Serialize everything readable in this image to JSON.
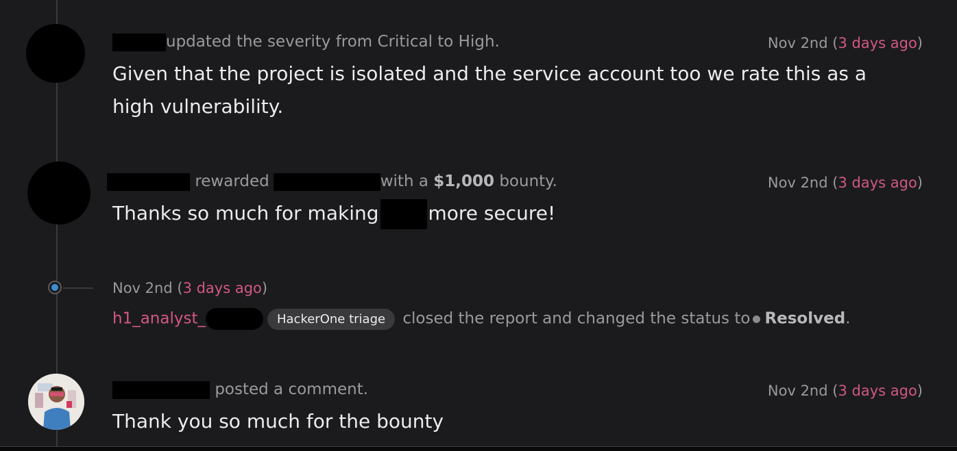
{
  "events": [
    {
      "action": "updated the severity from Critical to High.",
      "date": "Nov 2nd",
      "relative": "3 days ago",
      "body": "Given that the project is isolated and the service account too we rate this as a high vulnerability."
    },
    {
      "action_1": "rewarded",
      "action_2": "with a",
      "amount": "$1,000",
      "action_3": "bounty.",
      "date": "Nov 2nd",
      "relative": "3 days ago",
      "body_1": "Thanks so much for making",
      "body_2": "more secure!"
    },
    {
      "date": "Nov 2nd",
      "relative": "3 days ago",
      "analyst": "h1_analyst_",
      "badge": "HackerOne triage",
      "action": "closed the report and changed the status to",
      "status": "Resolved",
      "period": "."
    },
    {
      "action": "posted a comment.",
      "date": "Nov 2nd",
      "relative": "3 days ago",
      "body": "Thank you so much for the bounty"
    }
  ],
  "paren_open": "(",
  "paren_close": ")"
}
